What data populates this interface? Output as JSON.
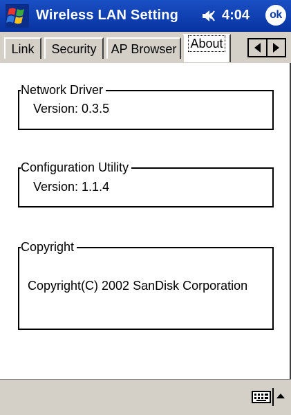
{
  "titlebar": {
    "app_title": "Wireless LAN Setting",
    "clock": "4:04",
    "ok_label": "ok",
    "color": "#0a39a8"
  },
  "tabs": [
    {
      "label": "Link",
      "active": false
    },
    {
      "label": "Security",
      "active": false
    },
    {
      "label": "AP Browser",
      "active": false
    },
    {
      "label": "About",
      "active": true
    }
  ],
  "content": {
    "network_driver": {
      "legend": "Network Driver",
      "value": "Version:  0.3.5"
    },
    "configuration_utility": {
      "legend": "Configuration Utility",
      "value": "Version:  1.1.4"
    },
    "copyright": {
      "legend": "Copyright",
      "value": "Copyright(C) 2002 SanDisk Corporation"
    }
  },
  "icons": {
    "start": "windows-flag-icon",
    "volume": "speaker-icon",
    "input": "keyboard-icon"
  }
}
